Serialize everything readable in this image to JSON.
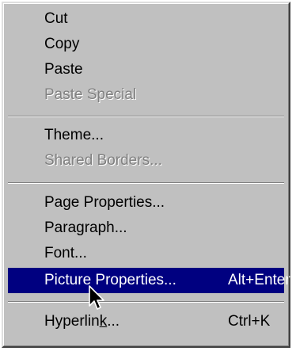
{
  "menu": {
    "items": [
      {
        "label": "Cut",
        "shortcut": "",
        "disabled": false
      },
      {
        "label": "Copy",
        "shortcut": "",
        "disabled": false
      },
      {
        "label": "Paste",
        "shortcut": "",
        "disabled": false
      },
      {
        "label": "Paste Special",
        "shortcut": "",
        "disabled": true
      },
      {
        "label": "Theme...",
        "shortcut": "",
        "disabled": false
      },
      {
        "label": "Shared Borders...",
        "shortcut": "",
        "disabled": true
      },
      {
        "label": "Page Properties...",
        "shortcut": "",
        "disabled": false
      },
      {
        "label": "Paragraph...",
        "shortcut": "",
        "disabled": false
      },
      {
        "label": "Font...",
        "shortcut": "",
        "disabled": false
      },
      {
        "label": "Picture Properties...",
        "shortcut": "Alt+Enter",
        "disabled": false,
        "highlighted": true
      },
      {
        "label_before": "Hyperlin",
        "label_underlined": "k",
        "label_after": "...",
        "shortcut": "Ctrl+K",
        "disabled": false
      }
    ]
  },
  "colors": {
    "menu_background": "#c0c0c0",
    "highlight_background": "#000080",
    "highlight_text": "#ffffff",
    "disabled_text": "#808080"
  },
  "cursor": {
    "icon": "arrow-cursor-icon"
  }
}
